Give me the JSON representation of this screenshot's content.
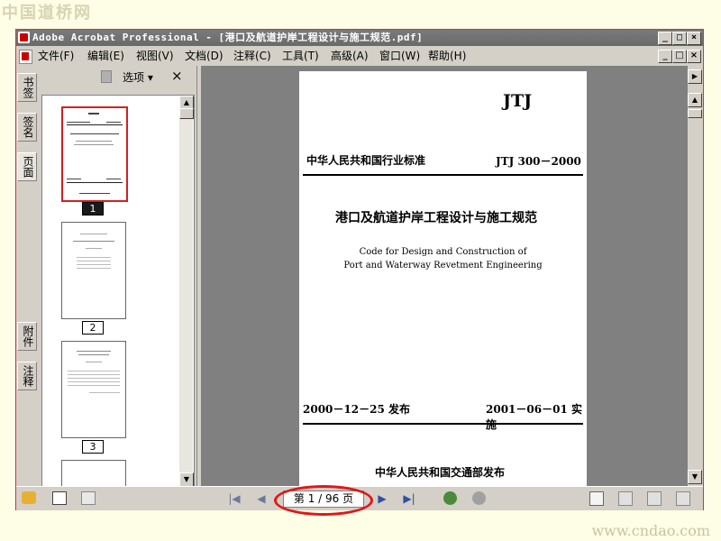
{
  "watermark": {
    "top": "中国道桥网",
    "bottom": "www.cndao.com"
  },
  "window": {
    "title": "Adobe Acrobat Professional - [港口及航道护岸工程设计与施工规范.pdf]",
    "controls": {
      "minimize": "_",
      "maximize": "□",
      "close": "×"
    }
  },
  "menu": [
    "文件(F)",
    "编辑(E)",
    "视图(V)",
    "文档(D)",
    "注释(C)",
    "工具(T)",
    "高级(A)",
    "窗口(W)",
    "帮助(H)"
  ],
  "sidebar": {
    "tabs_top": [
      "书签",
      "签名",
      "页面"
    ],
    "tabs_bottom": [
      "附件",
      "注释"
    ],
    "options_label": "选项",
    "close": "×",
    "thumbnails": [
      "1",
      "2",
      "3"
    ]
  },
  "document": {
    "code": "JTJ",
    "standard_label": "中华人民共和国行业标准",
    "standard_number": "JTJ 300－2000",
    "title_cn": "港口及航道护岸工程设计与施工规范",
    "title_en_line1": "Code for Design and Construction of",
    "title_en_line2": "Port and Waterway Revetment Engineering",
    "issue_date": "2000－12－25 发布",
    "effective_date": "2001－06－01 实施",
    "publisher": "中华人民共和国交通部发布"
  },
  "status": {
    "page_indicator": "第 1 / 96 页",
    "current_page": 1,
    "total_pages": 96
  },
  "colors": {
    "highlight": "#e01818",
    "titlebar": "#6e6e6e",
    "chrome": "#d4d0c8"
  }
}
